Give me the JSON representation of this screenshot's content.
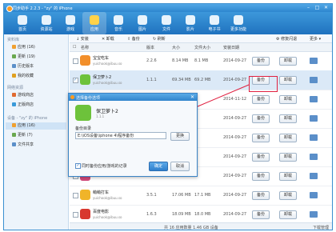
{
  "window": {
    "title": "同步助手 2.2.3 - \"zy\" 的 iPhone",
    "min": "–",
    "max": "□",
    "close": "✕"
  },
  "toolbar": [
    "首页",
    "资源站",
    "游戏",
    "应用",
    "音乐",
    "图片",
    "文件",
    "影片",
    "电子书",
    "更多功能"
  ],
  "sidebar": {
    "local_head": "资料库",
    "local_items": [
      {
        "label": "应用 (16)",
        "color": "#f0a030"
      },
      {
        "label": "更新 (19)",
        "color": "#6aa84f"
      },
      {
        "label": "历史版本",
        "color": "#5b8fc9"
      },
      {
        "label": "我的收藏",
        "color": "#e0a020"
      }
    ],
    "net_head": "网络资源",
    "net_items": [
      {
        "label": "游戏商店",
        "color": "#e06a30"
      },
      {
        "label": "正版商店",
        "color": "#3a9ad9"
      }
    ],
    "device_head": "设备 - \"zy\" 的 iPhone",
    "device_items": [
      {
        "label": "应用 (16)",
        "color": "#f0a030",
        "selected": true
      },
      {
        "label": "更新 (7)",
        "color": "#6aa84f"
      },
      {
        "label": "文件共享",
        "color": "#5b8fc9"
      }
    ]
  },
  "actions": {
    "install": "安装",
    "uninstall": "卸载",
    "backup": "备份",
    "refresh": "刷新",
    "repair": "修复闪退",
    "more": "更多"
  },
  "columns": [
    "名称",
    "版本",
    "大小",
    "文件大小",
    "安装日期"
  ],
  "rows": [
    {
      "name": "宝宝吃车",
      "sub": "yuichook@ibuu.so",
      "ver": "2.2.6",
      "size": "8.14 MB",
      "fsize": "8.1 MB",
      "date": "2014-09-27",
      "color": "#f28f2b"
    },
    {
      "name": "保卫萝卜2",
      "sub": "yuichook@ibuu.so",
      "ver": "1.1.1",
      "size": "69.34 MB",
      "fsize": "69.2 MB",
      "date": "2014-09-27",
      "color": "#6dc23b"
    },
    {
      "name": "",
      "sub": "",
      "ver": "",
      "size": "",
      "fsize": "",
      "date": "2014-11-12",
      "color": "#3d8ed8"
    },
    {
      "name": "",
      "sub": "",
      "ver": "",
      "size": "",
      "fsize": "",
      "date": "2014-09-27",
      "color": "#e85d3b"
    },
    {
      "name": "",
      "sub": "",
      "ver": "",
      "size": "",
      "fsize": "",
      "date": "2014-09-27",
      "color": "#8a6bd1"
    },
    {
      "name": "",
      "sub": "",
      "ver": "",
      "size": "",
      "fsize": "",
      "date": "2014-09-27",
      "color": "#2fb27f"
    },
    {
      "name": "",
      "sub": "",
      "ver": "",
      "size": "",
      "fsize": "",
      "date": "2014-09-27",
      "color": "#d14a7a"
    },
    {
      "name": "萌萌打车",
      "sub": "yuichook@ibuu.so",
      "ver": "3.5.1",
      "size": "17.06 MB",
      "fsize": "17.1 MB",
      "date": "2014-09-27",
      "color": "#f0b429"
    },
    {
      "name": "百度电影",
      "sub": "yuichook@ibuu.so",
      "ver": "1.6.3",
      "size": "18.09 MB",
      "fsize": "18.0 MB",
      "date": "2014-09-27",
      "color": "#d8382e"
    }
  ],
  "row_buttons": {
    "backup": "备份",
    "uninstall": "卸载"
  },
  "status": {
    "text": "共 16 应用数量 1.46 GB 设备",
    "right": "下载管理"
  },
  "dialog": {
    "title": "选择备份选项",
    "app_name": "保卫萝卜2",
    "app_version": "1.1.1",
    "label": "备份目录",
    "path": "E:\\iOS设备\\iphone 4\\程序备份",
    "browse": "更换",
    "checkbox": "同时备份应用/游戏的记录",
    "ok": "确定",
    "cancel": "取消"
  }
}
